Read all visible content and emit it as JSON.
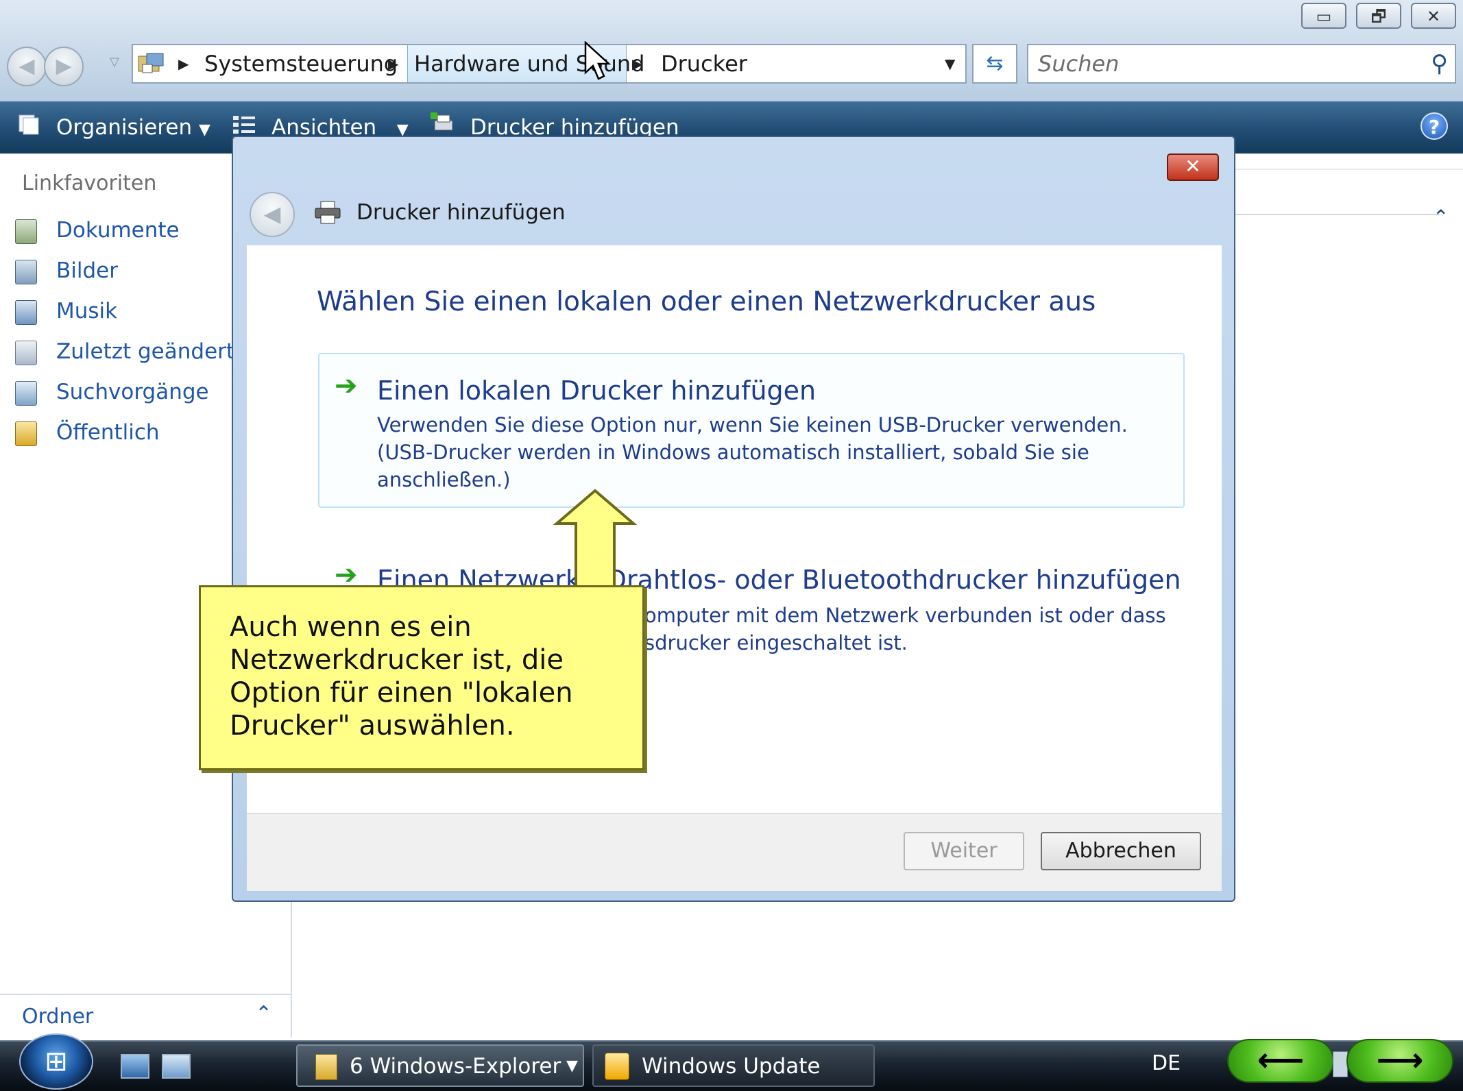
{
  "window": {
    "minimize_symbol": "▭",
    "restore_symbol": "🗗",
    "close_symbol": "✕"
  },
  "address": {
    "breadcrumbs": [
      "Systemsteuerung",
      "Hardware und Sound",
      "Drucker"
    ],
    "search_placeholder": "Suchen"
  },
  "toolbar": {
    "organize": "Organisieren",
    "views": "Ansichten",
    "add_printer": "Drucker hinzufügen",
    "help_symbol": "?"
  },
  "sidebar": {
    "title": "Linkfavoriten",
    "items": [
      {
        "label": "Dokumente",
        "icon": "documents-icon"
      },
      {
        "label": "Bilder",
        "icon": "pictures-icon"
      },
      {
        "label": "Musik",
        "icon": "music-icon"
      },
      {
        "label": "Zuletzt geändert",
        "icon": "recent-icon"
      },
      {
        "label": "Suchvorgänge",
        "icon": "searches-icon"
      },
      {
        "label": "Öffentlich",
        "icon": "public-folder-icon"
      }
    ],
    "folders_label": "Ordner"
  },
  "dialog": {
    "title": "Drucker hinzufügen",
    "heading": "Wählen Sie einen lokalen oder einen Netzwerkdrucker aus",
    "option_local": {
      "title": "Einen lokalen Drucker hinzufügen",
      "desc_line1": "Verwenden Sie diese Option nur, wenn Sie keinen USB-Drucker verwenden.",
      "desc_line2": "(USB-Drucker werden in Windows automatisch installiert, sobald Sie sie",
      "desc_line3": "anschließen.)"
    },
    "option_network": {
      "title_visible": "Einen Netzwerk-, Drahtlos- oder Bluetoothdrucker hinzufügen",
      "desc_line1_visible": "omputer mit dem Netzwerk verbunden ist oder dass",
      "desc_line2_visible": "sdrucker eingeschaltet ist."
    },
    "next_button": "Weiter",
    "cancel_button": "Abbrechen"
  },
  "callout": {
    "text": "Auch wenn es ein Netzwerkdrucker ist, die Option für einen \"lokalen Drucker\" auswählen."
  },
  "taskbar": {
    "explorer_button": "6 Windows-Explorer",
    "update_button": "Windows Update",
    "language": "DE",
    "back_arrow": "⟵",
    "forward_arrow": "⟶"
  },
  "colors": {
    "accent_blue": "#1e3c8c",
    "link_blue": "#1e57a8",
    "callout_yellow": "#ffff88",
    "option_arrow_green": "#25a21a"
  }
}
